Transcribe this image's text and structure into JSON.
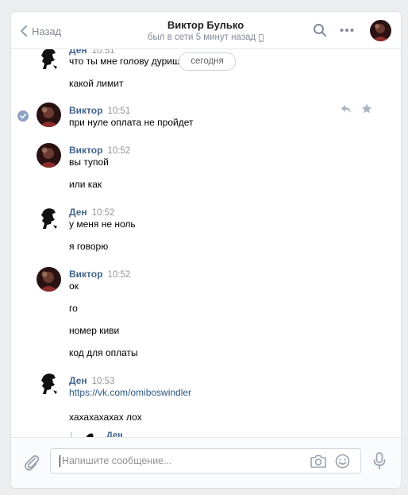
{
  "header": {
    "back_label": "Назад",
    "title": "Виктор Булько",
    "status": "был в сети 5 минут назад"
  },
  "history": {
    "date_badge": "сегодня",
    "groups": [
      {
        "author": "Ден",
        "time": "10:51",
        "messages": [
          "что ты мне голову дуриш",
          "какой лимит"
        ]
      },
      {
        "author": "Виктор",
        "time": "10:51",
        "messages": [
          "при нуле оплата не пройдет"
        ]
      },
      {
        "author": "Виктор",
        "time": "10:52",
        "messages": [
          "вы тупой",
          "или как"
        ]
      },
      {
        "author": "Ден",
        "time": "10:52",
        "messages": [
          "у меня не ноль",
          "я говорю"
        ]
      },
      {
        "author": "Виктор",
        "time": "10:52",
        "messages": [
          "ок",
          "го",
          "номер киви",
          "код для оплаты"
        ]
      },
      {
        "author": "Ден",
        "time": "10:53",
        "messages": [
          "https://vk.com/omiboswindler",
          "хахахахахах лох"
        ]
      }
    ],
    "quoted_author": "Ден"
  },
  "composer": {
    "placeholder": "Напишите сообщение..."
  },
  "icons": {
    "back": "chevron-left-icon",
    "search": "search-icon",
    "more": "more-dots-icon",
    "mobile": "mobile-phone-icon",
    "read": "check-circle-icon",
    "reply": "reply-icon",
    "favorite": "star-icon",
    "attach": "paperclip-icon",
    "camera": "camera-icon",
    "emoji": "smile-icon",
    "mic": "microphone-icon"
  },
  "colors": {
    "author": "#42648b",
    "link": "#2a5885",
    "muted": "#828a99",
    "background": "#edeef0"
  }
}
